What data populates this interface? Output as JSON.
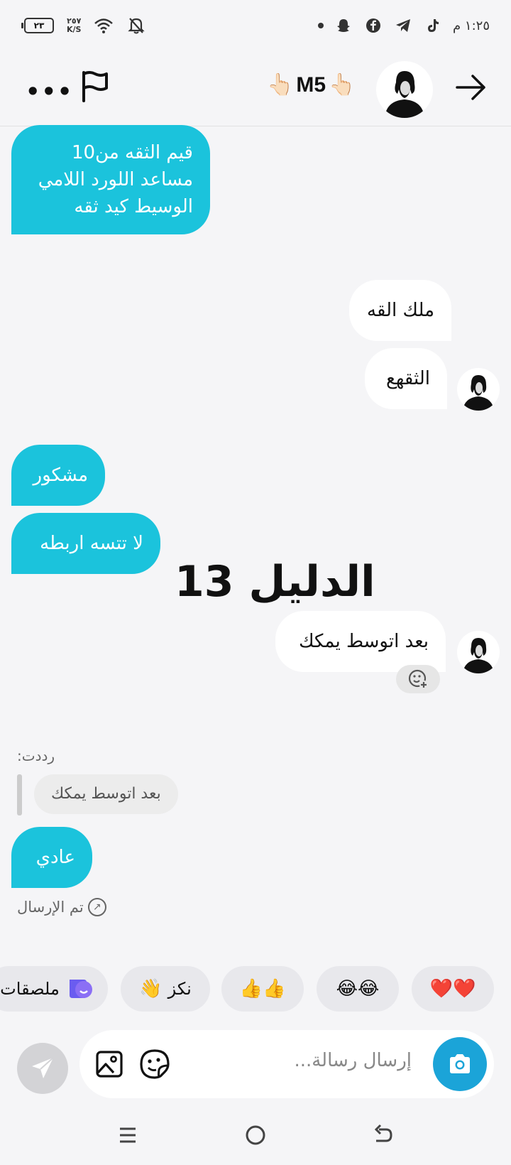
{
  "status_bar": {
    "time": "١:٢٥ م",
    "battery": "٢٣",
    "net_speed_value": "٢٥٧",
    "net_speed_unit": "K/S",
    "icons": [
      "battery-icon",
      "wifi-icon",
      "mute-icon",
      "tiktok-icon",
      "telegram-icon",
      "facebook-icon",
      "snapchat-icon",
      "notification-dot"
    ]
  },
  "header": {
    "title_prefix_emoji": "👆🏻",
    "title": "M5",
    "title_suffix_emoji": "👆🏻",
    "more_label": "•••",
    "icons": [
      "more-icon",
      "flag-icon",
      "avatar",
      "back-arrow-icon"
    ]
  },
  "messages": [
    {
      "direction": "in",
      "text_lines": [
        "قيم الثقه من10",
        "مساعد اللورد اللامي",
        "الوسيط كيد ثقه"
      ]
    },
    {
      "direction": "out",
      "text": "ملك القه"
    },
    {
      "direction": "out",
      "text": "الثقهع"
    },
    {
      "direction": "in",
      "text": "مشكور"
    },
    {
      "direction": "in",
      "text": "لا تتسه اربطه"
    },
    {
      "direction": "out",
      "text": "بعد اتوسط يمكك"
    },
    {
      "direction": "in",
      "text": "عادي"
    }
  ],
  "overlay_text": "الدليل 13",
  "reply": {
    "label": "رددت:",
    "quoted_text": "بعد اتوسط يمكك"
  },
  "sent_status": "تم الإرسال",
  "quick_reactions": [
    {
      "emoji": "❤️❤️"
    },
    {
      "emoji": "😂😂"
    },
    {
      "emoji": "👍👍"
    },
    {
      "emoji": "👋",
      "label": "نكز"
    },
    {
      "emoji": "",
      "label": "ملصقات"
    }
  ],
  "composer": {
    "placeholder": "إرسال رسالة..."
  },
  "colors": {
    "incoming_bubble": "#1bc3dc",
    "camera_button": "#1ba4d8",
    "background": "#f5f5f7"
  }
}
